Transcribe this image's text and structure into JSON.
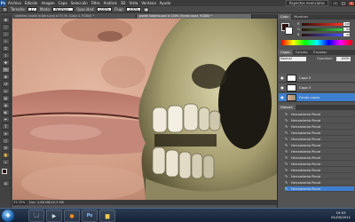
{
  "app": {
    "logo": "Ps",
    "menu": [
      "Archivo",
      "Edición",
      "Imagen",
      "Capa",
      "Selección",
      "Filtro",
      "Análisis",
      "3D",
      "Vista",
      "Ventana",
      "Ayuda"
    ],
    "workspace": "Aspectos esenciales"
  },
  "options": {
    "size_label": "Tamaño:",
    "size_value": "17",
    "mode_label": "Modo:",
    "mode_value": "Normal",
    "opacity_label": "Opacidad:",
    "opacity_value": "100%",
    "flow_label": "Flujo:",
    "flow_value": "100%"
  },
  "tabs": [
    {
      "label": "ubiertes caudal la labra.png al 33,3% (Capa 4, RGB/8) *",
      "active": false
    },
    {
      "label": "puede Sobrevo.psd al 100% (Fondo copia, RGB/8) *",
      "active": true
    }
  ],
  "status": {
    "zoom": "33,33%",
    "doc": "Doc: 4,88 MB/16,3 MB"
  },
  "panels": {
    "color_tabs": [
      "Color",
      "Muestras"
    ],
    "color_values": {
      "r": "246",
      "g": "88",
      "b": "42"
    },
    "colors": {
      "fg": "#2a0f0b",
      "bg": "#ffffff"
    },
    "layer_tabs": [
      "Capas",
      "Canales",
      "Trazados"
    ],
    "blend_mode": "Normal",
    "opacity_label": "Opacidad:",
    "opacity_value": "100%",
    "layers": [
      {
        "name": "Capa 5",
        "active": false
      },
      {
        "name": "Capa 3",
        "active": false
      },
      {
        "name": "Fondo copia",
        "active": true
      }
    ],
    "history_tab": "Historia",
    "history": [
      "Herramienta Pincel",
      "Herramienta Pincel",
      "Herramienta Pincel",
      "Herramienta Pincel",
      "Herramienta Pincel",
      "Herramienta Pincel",
      "Herramienta Pincel",
      "Herramienta Pincel",
      "Herramienta Pincel",
      "Herramienta Pincel",
      "Herramienta Pincel",
      "Herramienta Pincel",
      "Herramienta Pincel"
    ],
    "history_active_index": 12
  },
  "taskbar": {
    "apps": [
      "explorer-icon",
      "media-player-icon",
      "firefox-icon",
      "photoshop-icon",
      "folder-icon"
    ],
    "time": "15:03",
    "date": "01/05/2011"
  }
}
